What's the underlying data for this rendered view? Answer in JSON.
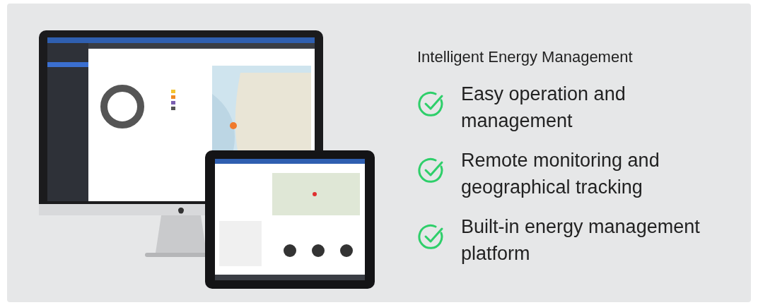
{
  "heading": "Intelligent Energy Management",
  "features": [
    {
      "text": "Easy operation and management"
    },
    {
      "text": "Remote monitoring and geographical tracking"
    },
    {
      "text": "Built-in energy management platform"
    }
  ]
}
